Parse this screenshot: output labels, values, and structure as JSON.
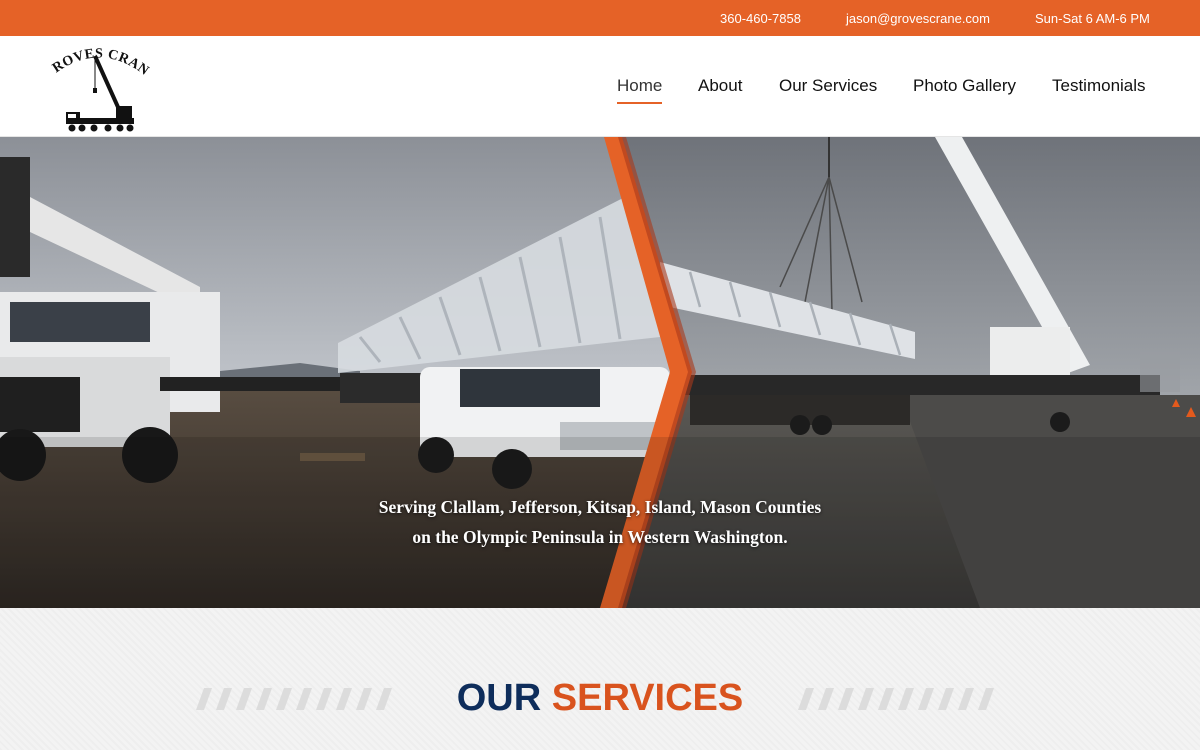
{
  "topbar": {
    "phone": "360-460-7858",
    "email": "jason@grovescrane.com",
    "hours": "Sun-Sat 6 AM-6 PM"
  },
  "logo": {
    "text": "GROVES CRANE"
  },
  "nav": {
    "items": [
      {
        "label": "Home",
        "active": true
      },
      {
        "label": "About"
      },
      {
        "label": "Our Services"
      },
      {
        "label": "Photo Gallery"
      },
      {
        "label": "Testimonials"
      }
    ]
  },
  "hero": {
    "caption_line1": "Serving Clallam, Jefferson, Kitsap, Island, Mason Counties",
    "caption_line2": "on the Olympic Peninsula in Western Washington."
  },
  "services": {
    "title_word1": "OUR",
    "title_word2": "SERVICES"
  },
  "colors": {
    "accent": "#e56227",
    "navy": "#0e2d5b",
    "services_orange": "#d9531e"
  }
}
